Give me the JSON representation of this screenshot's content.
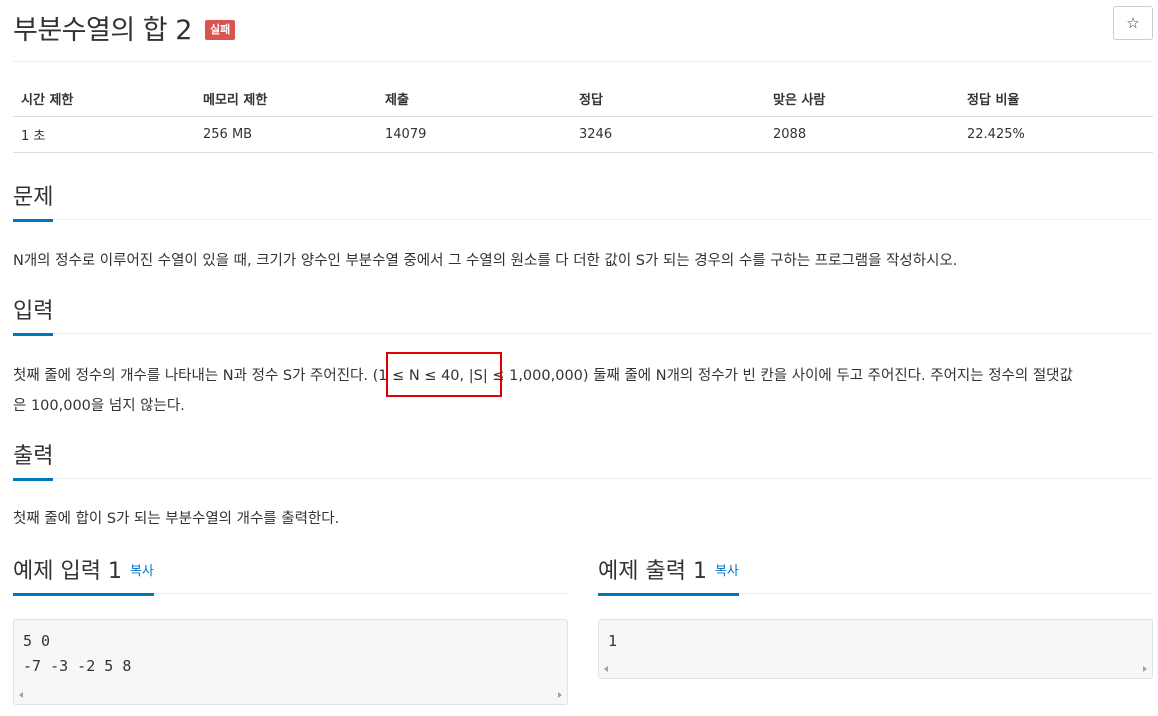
{
  "problem": {
    "title": "부분수열의 합 2",
    "result_badge": "실패",
    "star_icon": "☆"
  },
  "info_table": {
    "headers": [
      "시간 제한",
      "메모리 제한",
      "제출",
      "정답",
      "맞은 사람",
      "정답 비율"
    ],
    "values": [
      "1 초",
      "256 MB",
      "14079",
      "3246",
      "2088",
      "22.425%"
    ]
  },
  "sections": {
    "description": {
      "heading": "문제",
      "text": "N개의 정수로 이루어진 수열이 있을 때, 크기가 양수인 부분수열 중에서 그 수열의 원소를 다 더한 값이 S가 되는 경우의 수를 구하는 프로그램을 작성하시오."
    },
    "input": {
      "heading": "입력",
      "line1": "첫째 줄에 정수의 개수를 나타내는 N과 정수 S가 주어진다. (1 ≤ N ≤ 40, |S| ≤ 1,000,000) 둘째 줄에 N개의 정수가 빈 칸을 사이에 두고 주어진다. 주어지는 정수의 절댓값",
      "line2": "은 100,000을 넘지 않는다."
    },
    "output": {
      "heading": "출력",
      "text": "첫째 줄에 합이 S가 되는 부분수열의 개수를 출력한다."
    }
  },
  "examples": {
    "input": {
      "heading": "예제 입력 1",
      "copy_label": "복사",
      "lines": [
        "5 0",
        "-7 -3 -2 5 8"
      ]
    },
    "output": {
      "heading": "예제 출력 1",
      "copy_label": "복사",
      "lines": [
        "1"
      ]
    }
  },
  "colors": {
    "accent": "#0076c0",
    "badge_fail": "#d9534f",
    "highlight": "#e00000"
  }
}
